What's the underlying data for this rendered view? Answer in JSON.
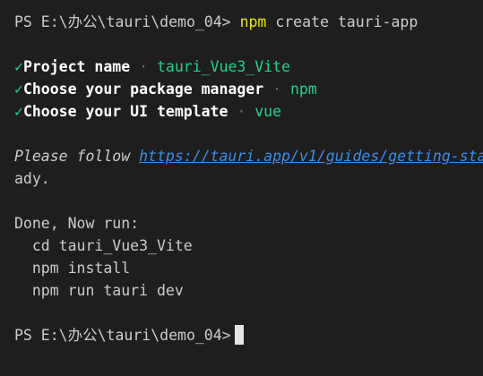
{
  "terminal": {
    "prompt1": "PS E:\\办公\\tauri\\demo_04>",
    "cmd_npm": "npm",
    "cmd_rest": "create tauri-app",
    "check_mark": "✓",
    "dot_sep": "·",
    "steps": [
      {
        "label": "Project name",
        "value": "tauri_Vue3_Vite"
      },
      {
        "label": "Choose your package manager",
        "value": "npm"
      },
      {
        "label": "Choose your UI template",
        "value": "vue"
      }
    ],
    "follow_text": "Please follow",
    "follow_link": "https://tauri.app/v1/guides/getting-sta",
    "follow_tail": "ady.",
    "done_text": "Done, Now run:",
    "run_cmds": [
      "cd tauri_Vue3_Vite",
      "npm install",
      "npm run tauri dev"
    ],
    "prompt2": "PS E:\\办公\\tauri\\demo_04>"
  },
  "colors": {
    "background": "#1e1e1e",
    "foreground": "#cccccc",
    "green": "#23d18b",
    "yellow": "#e5e510",
    "link": "#3b8eea"
  }
}
